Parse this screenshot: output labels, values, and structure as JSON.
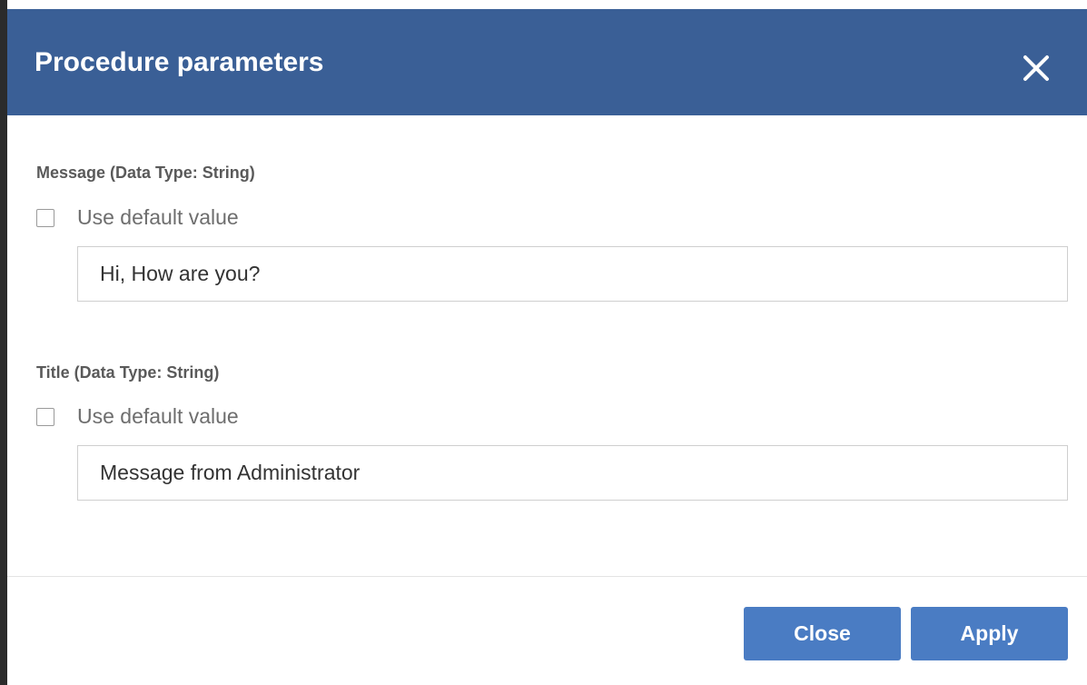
{
  "dialog": {
    "title": "Procedure parameters",
    "header_color": "#3a5f96",
    "close_icon": "close-icon"
  },
  "parameters": [
    {
      "label": "Message (Data Type: String)",
      "use_default_label": "Use default value",
      "use_default_checked": false,
      "value": "Hi, How are you?"
    },
    {
      "label": "Title (Data Type: String)",
      "use_default_label": "Use default value",
      "use_default_checked": false,
      "value": "Message from Administrator"
    }
  ],
  "footer": {
    "close_label": "Close",
    "apply_label": "Apply",
    "button_color": "#4a7cc3"
  }
}
